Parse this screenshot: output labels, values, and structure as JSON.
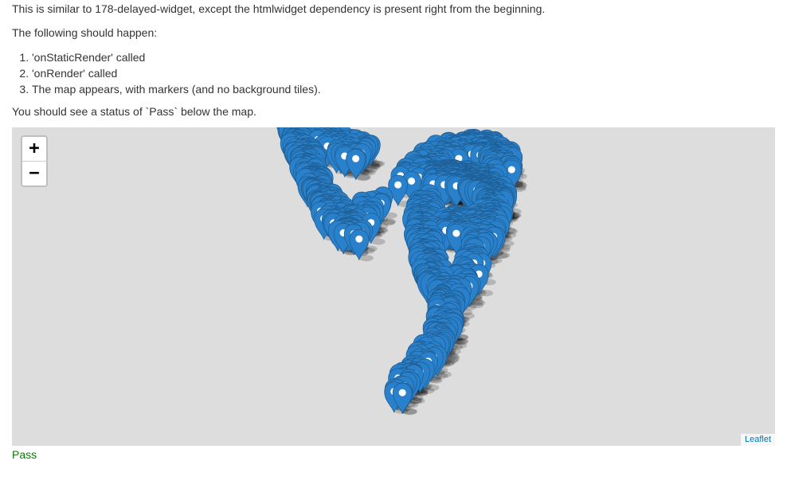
{
  "intro_text": "This is similar to 178-delayed-widget, except the htmlwidget dependency is present right from the beginning.",
  "following_text": "The following should happen:",
  "steps": [
    "'onStaticRender' called",
    "'onRender' called",
    "The map appears, with markers (and no background tiles)."
  ],
  "see_text": "You should see a status of `Pass` below the map.",
  "map": {
    "zoom_in_label": "+",
    "zoom_out_label": "−",
    "attribution": "Leaflet",
    "marker_icon": "map-pin-marker-icon",
    "marker_color": "#2a81cb"
  },
  "status": {
    "text": "Pass",
    "color": "#008000"
  }
}
